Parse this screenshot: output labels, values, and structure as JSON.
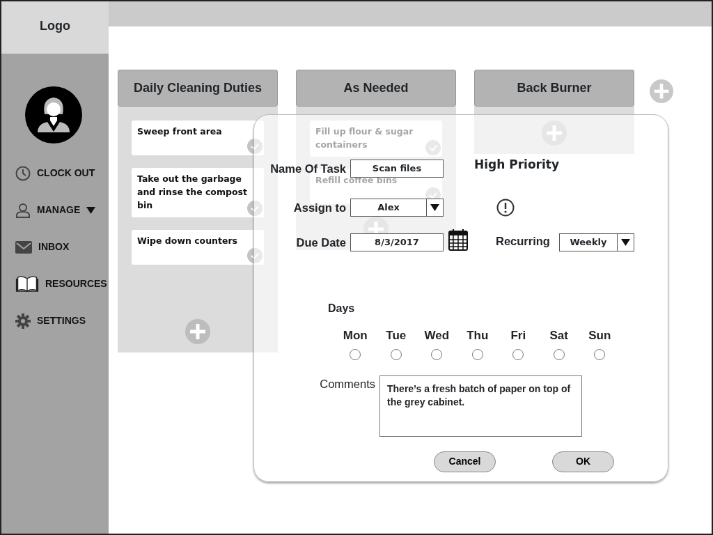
{
  "logo": "Logo",
  "sidebar": {
    "items": [
      {
        "kind": "clock",
        "label": "CLOCK OUT"
      },
      {
        "kind": "user",
        "label": "MANAGE",
        "dropdown": true
      },
      {
        "kind": "mail",
        "label": "INBOX"
      },
      {
        "kind": "book",
        "label": "RESOURCES"
      },
      {
        "kind": "gear",
        "label": "SETTINGS"
      }
    ]
  },
  "columns": [
    {
      "title": "Daily Cleaning Duties",
      "cards": [
        "Sweep front area",
        "Take out the garbage and rinse the compost bin",
        "Wipe down counters"
      ]
    },
    {
      "title": "As Needed",
      "cards": [
        "Fill up flour & sugar containers",
        "Refill coffee bins"
      ]
    },
    {
      "title": "Back Burner"
    }
  ],
  "dialog": {
    "fields": [
      {
        "kind": "text",
        "label": "Name Of Task",
        "value": "Scan files"
      },
      {
        "kind": "select",
        "label": "Assign to",
        "value": "Alex"
      },
      {
        "kind": "date",
        "label": "Due Date",
        "value": "8/3/2017"
      }
    ],
    "priority_label": "High Priority",
    "recurring": {
      "label": "Recurring",
      "value": "Weekly"
    },
    "days_label": "Days",
    "days": [
      {
        "label": "Mon",
        "selected": false
      },
      {
        "label": "Tue",
        "selected": false
      },
      {
        "label": "Wed",
        "selected": false
      },
      {
        "label": "Thu",
        "selected": false
      },
      {
        "label": "Fri",
        "selected": false
      },
      {
        "label": "Sat",
        "selected": false
      },
      {
        "label": "Sun",
        "selected": false
      }
    ],
    "comments": {
      "label": "Comments",
      "value": "There’s a fresh batch of paper on top of the grey cabinet."
    },
    "buttons": [
      "Cancel",
      "OK"
    ]
  }
}
